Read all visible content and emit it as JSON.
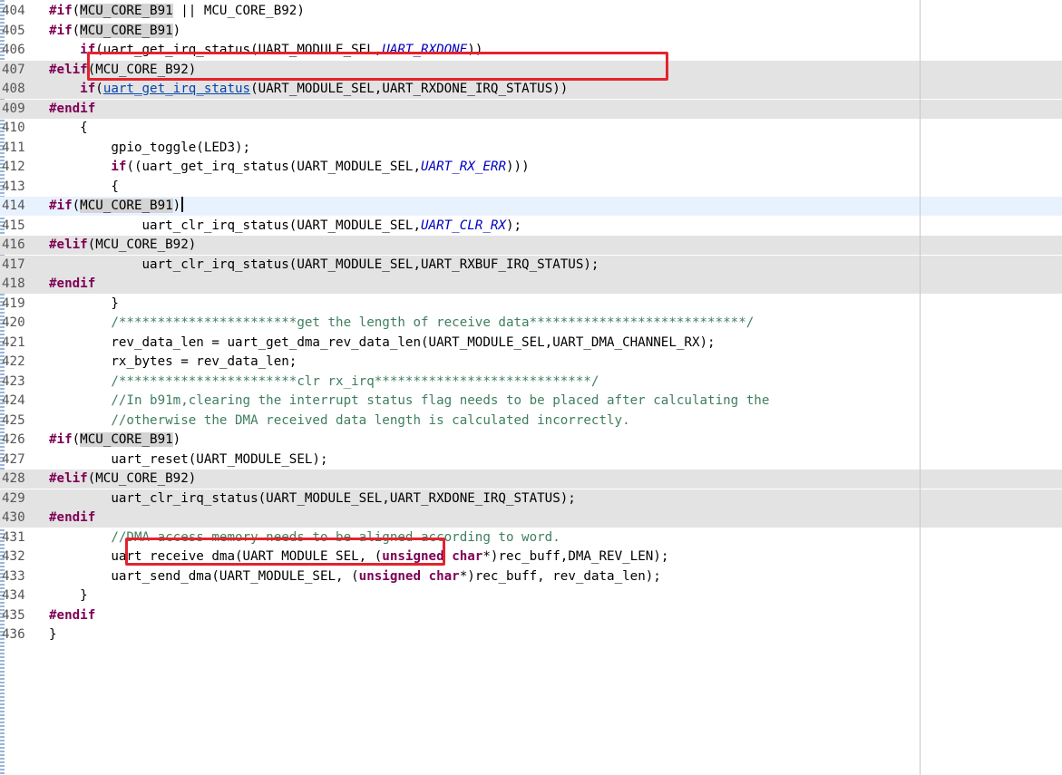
{
  "editor": {
    "lines": [
      {
        "num": "404",
        "style": "plain",
        "tokens": [
          {
            "t": "#if",
            "c": "kw"
          },
          {
            "t": "(",
            "c": ""
          },
          {
            "t": "MCU_CORE_B91",
            "c": "inact"
          },
          {
            "t": " || ",
            "c": ""
          },
          {
            "t": "MCU_CORE_B92",
            "c": ""
          },
          {
            "t": ")",
            "c": ""
          }
        ]
      },
      {
        "num": "405",
        "style": "plain",
        "tokens": [
          {
            "t": "#if",
            "c": "kw"
          },
          {
            "t": "(",
            "c": ""
          },
          {
            "t": "MCU_CORE_B91",
            "c": "inact"
          },
          {
            "t": ")",
            "c": ""
          }
        ]
      },
      {
        "num": "406",
        "style": "plain",
        "tokens": [
          {
            "t": "    ",
            "c": ""
          },
          {
            "t": "if",
            "c": "kw"
          },
          {
            "t": "(uart_get_irq_status(UART_MODULE_SEL,",
            "c": ""
          },
          {
            "t": "UART_RXDONE",
            "c": "macro"
          },
          {
            "t": "))",
            "c": ""
          }
        ]
      },
      {
        "num": "407",
        "style": "hl",
        "tokens": [
          {
            "t": "#elif",
            "c": "kw"
          },
          {
            "t": "(MCU_CORE_B92)",
            "c": ""
          }
        ]
      },
      {
        "num": "408",
        "style": "hl",
        "tokens": [
          {
            "t": "    ",
            "c": ""
          },
          {
            "t": "if",
            "c": "kw"
          },
          {
            "t": "(",
            "c": ""
          },
          {
            "t": "uart_get_irq_status",
            "c": "lnk"
          },
          {
            "t": "(UART_MODULE_SEL,UART_RXDONE_IRQ_STATUS))",
            "c": ""
          }
        ]
      },
      {
        "num": "409",
        "style": "hl",
        "tokens": [
          {
            "t": "#endif",
            "c": "kw"
          }
        ]
      },
      {
        "num": "410",
        "style": "plain",
        "tokens": [
          {
            "t": "    {",
            "c": ""
          }
        ]
      },
      {
        "num": "411",
        "style": "plain",
        "tokens": [
          {
            "t": "        gpio_toggle(LED3);",
            "c": ""
          }
        ]
      },
      {
        "num": "412",
        "style": "plain",
        "tokens": [
          {
            "t": "        ",
            "c": ""
          },
          {
            "t": "if",
            "c": "kw"
          },
          {
            "t": "((uart_get_irq_status(UART_MODULE_SEL,",
            "c": ""
          },
          {
            "t": "UART_RX_ERR",
            "c": "macro"
          },
          {
            "t": ")))",
            "c": ""
          }
        ]
      },
      {
        "num": "413",
        "style": "plain",
        "tokens": [
          {
            "t": "        {",
            "c": ""
          }
        ]
      },
      {
        "num": "414",
        "style": "cur",
        "tokens": [
          {
            "t": "#if",
            "c": "kw"
          },
          {
            "t": "(",
            "c": ""
          },
          {
            "t": "MCU_CORE_B91",
            "c": "inact"
          },
          {
            "t": ")",
            "c": ""
          },
          {
            "t": "",
            "c": "caret"
          }
        ]
      },
      {
        "num": "415",
        "style": "plain",
        "tokens": [
          {
            "t": "            uart_clr_irq_status(UART_MODULE_SEL,",
            "c": ""
          },
          {
            "t": "UART_CLR_RX",
            "c": "macro"
          },
          {
            "t": ");",
            "c": ""
          }
        ]
      },
      {
        "num": "416",
        "style": "hl",
        "tokens": [
          {
            "t": "#elif",
            "c": "kw"
          },
          {
            "t": "(MCU_CORE_B92)",
            "c": ""
          }
        ]
      },
      {
        "num": "417",
        "style": "hl",
        "tokens": [
          {
            "t": "            uart_clr_irq_status(UART_MODULE_SEL,UART_RXBUF_IRQ_STATUS);",
            "c": ""
          }
        ]
      },
      {
        "num": "418",
        "style": "hl",
        "tokens": [
          {
            "t": "#endif",
            "c": "kw"
          }
        ]
      },
      {
        "num": "419",
        "style": "plain",
        "tokens": [
          {
            "t": "        }",
            "c": ""
          }
        ]
      },
      {
        "num": "420",
        "style": "plain",
        "tokens": [
          {
            "t": "        /***********************get the length of receive data****************************/",
            "c": "cm"
          }
        ]
      },
      {
        "num": "421",
        "style": "plain",
        "tokens": [
          {
            "t": "        rev_data_len = uart_get_dma_rev_data_len(UART_MODULE_SEL,UART_DMA_CHANNEL_RX);",
            "c": ""
          }
        ]
      },
      {
        "num": "422",
        "style": "plain",
        "tokens": [
          {
            "t": "        rx_bytes = rev_data_len;",
            "c": ""
          }
        ]
      },
      {
        "num": "423",
        "style": "plain",
        "tokens": [
          {
            "t": "        /***********************clr rx_irq****************************/",
            "c": "cm"
          }
        ]
      },
      {
        "num": "424",
        "style": "plain",
        "tokens": [
          {
            "t": "        //In b91m,clearing the interrupt status flag needs to be placed after calculating the",
            "c": "cm"
          }
        ]
      },
      {
        "num": "425",
        "style": "plain",
        "tokens": [
          {
            "t": "        //otherwise the DMA received data length is calculated incorrectly.",
            "c": "cm"
          }
        ]
      },
      {
        "num": "426",
        "style": "plain",
        "tokens": [
          {
            "t": "#if",
            "c": "kw"
          },
          {
            "t": "(",
            "c": ""
          },
          {
            "t": "MCU_CORE_B91",
            "c": "inact"
          },
          {
            "t": ")",
            "c": ""
          }
        ]
      },
      {
        "num": "427",
        "style": "plain",
        "tokens": [
          {
            "t": "        uart_reset(UART_MODULE_SEL);",
            "c": ""
          }
        ]
      },
      {
        "num": "428",
        "style": "hl",
        "tokens": [
          {
            "t": "#elif",
            "c": "kw"
          },
          {
            "t": "(MCU_CORE_B92)",
            "c": ""
          }
        ]
      },
      {
        "num": "429",
        "style": "hl",
        "tokens": [
          {
            "t": "        uart_clr_irq_status(UART_MODULE_SEL,UART_RXDONE_IRQ_STATUS);",
            "c": ""
          }
        ]
      },
      {
        "num": "430",
        "style": "hl",
        "tokens": [
          {
            "t": "#endif",
            "c": "kw"
          }
        ]
      },
      {
        "num": "431",
        "style": "plain",
        "tokens": [
          {
            "t": "        //DMA access memory needs to be aligned according to word.",
            "c": "cm"
          }
        ]
      },
      {
        "num": "432",
        "style": "plain",
        "tokens": [
          {
            "t": "        uart_receive_dma(UART_MODULE_SEL, (",
            "c": ""
          },
          {
            "t": "unsigned",
            "c": "kw2"
          },
          {
            "t": " ",
            "c": ""
          },
          {
            "t": "char",
            "c": "kw2"
          },
          {
            "t": "*)rec_buff,DMA_REV_LEN);",
            "c": ""
          }
        ]
      },
      {
        "num": "433",
        "style": "plain",
        "tokens": [
          {
            "t": "        uart_send_dma(UART_MODULE_SEL, (",
            "c": ""
          },
          {
            "t": "unsigned",
            "c": "kw2"
          },
          {
            "t": " ",
            "c": ""
          },
          {
            "t": "char",
            "c": "kw2"
          },
          {
            "t": "*)rec_buff, rev_data_len);",
            "c": ""
          }
        ]
      },
      {
        "num": "434",
        "style": "plain",
        "tokens": [
          {
            "t": "    }",
            "c": ""
          }
        ]
      },
      {
        "num": "435",
        "style": "plain",
        "tokens": [
          {
            "t": "#endif",
            "c": "kw"
          }
        ]
      },
      {
        "num": "436",
        "style": "plain",
        "tokens": [
          {
            "t": "}",
            "c": ""
          }
        ]
      }
    ]
  }
}
